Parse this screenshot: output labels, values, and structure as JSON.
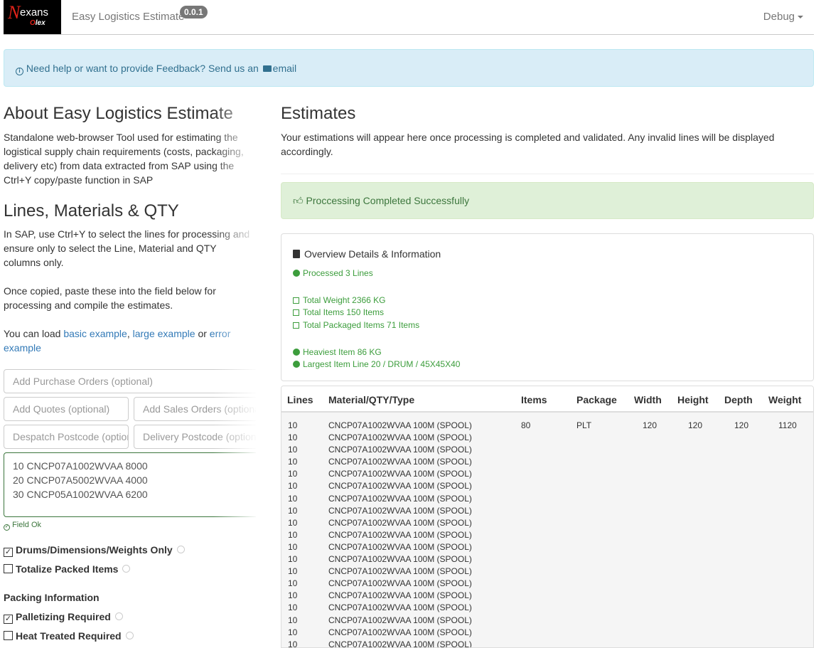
{
  "navbar": {
    "logo_n": "N",
    "logo_exans": "exans",
    "logo_o": "O",
    "logo_olex": "lex",
    "brand": "Easy Logistics Estimate",
    "version": "0.0.1",
    "debug": "Debug"
  },
  "info_alert": {
    "text": "Need help or want to provide Feedback? Send us an",
    "link": "email"
  },
  "about": {
    "title_main": "About Easy ",
    "title_mid": "Logistics",
    "title_end": " Estimate",
    "text": "Standalone web-browser Tool used for estimating the logistical supply chain requirements (costs, packaging, delivery etc) from data extracted from SAP using the Ctrl+Y copy/paste function in SAP"
  },
  "lines": {
    "title_main": "Lines, Materials ",
    "title_amp": "& ",
    "title_qty": "QTY",
    "text1": "In SAP, use Ctrl+Y to select the lines for processing and ensure only to select the Line, Material and QTY columns only.",
    "text2": "Once copied, paste these into the field below for processing and compile the estimates.",
    "text3_prefix": "You can load ",
    "link_basic": "basic example",
    "sep1": ", ",
    "link_large": "large example",
    "sep2": " or ",
    "link_error": "error example"
  },
  "form": {
    "purchase_orders": "Add Purchase Orders (optional)",
    "quotes": "Add Quotes (optional)",
    "sales_orders": "Add Sales Orders (optional)",
    "despatch": "Despatch Postcode (optional)",
    "delivery": "Delivery Postcode (optional)",
    "textarea_lines": [
      "10 CNCP07A1002WVAA 8000",
      "20 CNCP07A5002WVAA 4000",
      "30 CNCP05A1002WVAA 6200"
    ],
    "field_ok": "Field Ok"
  },
  "options": {
    "drums": "Drums/Dimensions/Weights Only",
    "drums_checked": true,
    "totalize": "Totalize Packed Items",
    "totalize_checked": false,
    "packing_header": "Packing Information",
    "palletizing": "Palletizing Required",
    "palletizing_checked": true,
    "heat_treated": "Heat Treated Required",
    "heat_treated_checked": false
  },
  "estimates": {
    "title": "Estimates",
    "text": "Your estimations will appear here once processing is completed and validated. Any invalid lines will be displayed accordingly.",
    "success": "Proccessing Completed Successfully"
  },
  "overview": {
    "title": "Overview Details & Information",
    "processed": "Processed 3 Lines",
    "total_weight": "Total Weight 2366 KG",
    "total_items": "Total Items 150 Items",
    "total_packaged": "Total Packaged Items 71 Items",
    "heaviest": "Heaviest Item 86 KG",
    "largest": "Largest Item Line 20 / DRUM / 45X45X40"
  },
  "table": {
    "headers": [
      "Lines",
      "Material/QTY/Type",
      "Items",
      "Package",
      "Width",
      "Height",
      "Depth",
      "Weight"
    ],
    "first_row": {
      "line": "10",
      "material": "CNCP07A1002WVAA 100M (SPOOL)",
      "items": "80",
      "package": "PLT",
      "width": "120",
      "height": "120",
      "depth": "120",
      "weight": "1120"
    },
    "rows": [
      {
        "line": "10",
        "material": "CNCP07A1002WVAA 100M (SPOOL)"
      },
      {
        "line": "10",
        "material": "CNCP07A1002WVAA 100M (SPOOL)"
      },
      {
        "line": "10",
        "material": "CNCP07A1002WVAA 100M (SPOOL)"
      },
      {
        "line": "10",
        "material": "CNCP07A1002WVAA 100M (SPOOL)"
      },
      {
        "line": "10",
        "material": "CNCP07A1002WVAA 100M (SPOOL)"
      },
      {
        "line": "10",
        "material": "CNCP07A1002WVAA 100M (SPOOL)"
      },
      {
        "line": "10",
        "material": "CNCP07A1002WVAA 100M (SPOOL)"
      },
      {
        "line": "10",
        "material": "CNCP07A1002WVAA 100M (SPOOL)"
      },
      {
        "line": "10",
        "material": "CNCP07A1002WVAA 100M (SPOOL)"
      },
      {
        "line": "10",
        "material": "CNCP07A1002WVAA 100M (SPOOL)"
      },
      {
        "line": "10",
        "material": "CNCP07A1002WVAA 100M (SPOOL)"
      },
      {
        "line": "10",
        "material": "CNCP07A1002WVAA 100M (SPOOL)"
      },
      {
        "line": "10",
        "material": "CNCP07A1002WVAA 100M (SPOOL)"
      },
      {
        "line": "10",
        "material": "CNCP07A1002WVAA 100M (SPOOL)"
      },
      {
        "line": "10",
        "material": "CNCP07A1002WVAA 100M (SPOOL)"
      },
      {
        "line": "10",
        "material": "CNCP07A1002WVAA 100M (SPOOL)"
      },
      {
        "line": "10",
        "material": "CNCP07A1002WVAA 100M (SPOOL)"
      },
      {
        "line": "10",
        "material": "CNCP07A1002WVAA 100M (SPOOL)"
      }
    ]
  },
  "colors": {
    "success_text": "#3c763d",
    "info_text": "#31708f",
    "link": "#337ab7"
  }
}
